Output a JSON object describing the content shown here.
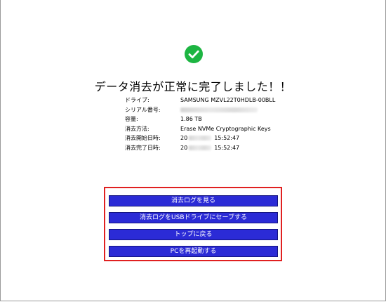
{
  "header": {
    "title": "データ消去が正常に完了しました！！"
  },
  "icon": {
    "name": "check-circle-icon",
    "color": "#1db542"
  },
  "info": {
    "drive": {
      "label": "ドライブ:",
      "value": "SAMSUNG MZVL22T0HDLB-00BLL"
    },
    "serial": {
      "label": "シリアル番号:",
      "value": ""
    },
    "capacity": {
      "label": "容量:",
      "value": "1.86 TB"
    },
    "method": {
      "label": "消去方法:",
      "value": "Erase NVMe Cryptographic Keys"
    },
    "start": {
      "label": "消去開始日時:",
      "prefix": "20",
      "time": "15:52:47"
    },
    "end": {
      "label": "消去完了日時:",
      "prefix": "20",
      "time": "15:52:47"
    }
  },
  "actions": {
    "view_log": "消去ログを見る",
    "save_log_usb": "消去ログをUSBドライブにセーブする",
    "back_top": "トップに戻る",
    "restart_pc": "PCを再起動する"
  },
  "colors": {
    "button_bg": "#2b2bd6",
    "highlight": "#e02020"
  }
}
